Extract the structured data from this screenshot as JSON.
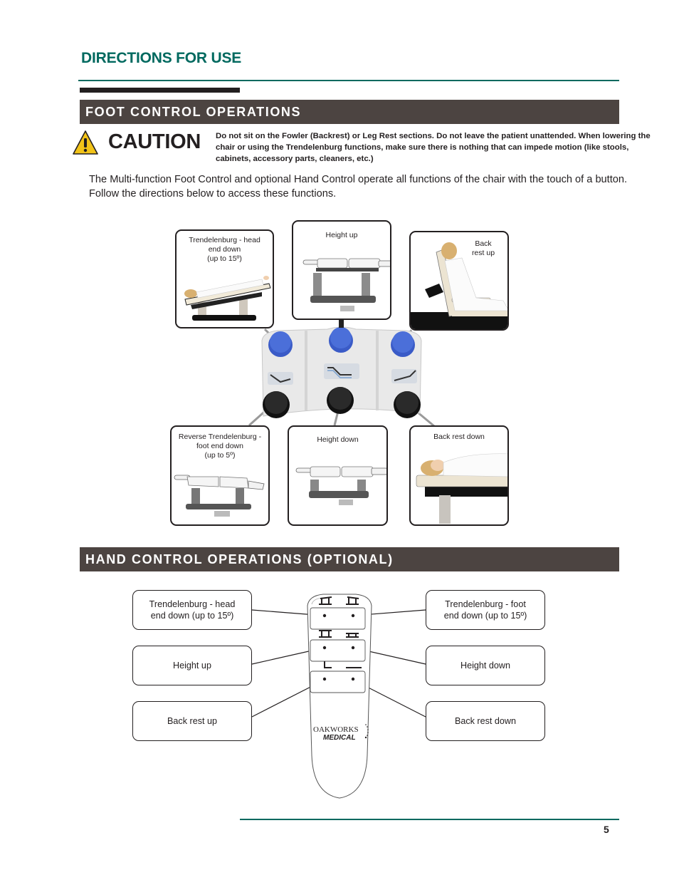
{
  "page": {
    "heading": "DIRECTIONS FOR USE",
    "page_number": "5",
    "colors": {
      "teal": "#00695f",
      "band": "#4c4441",
      "caution_yellow": "#f2c318",
      "pedal_blue": "#3a5bc7",
      "pedal_black": "#1e1e1e"
    }
  },
  "foot_section": {
    "title": "FOOT CONTROL OPERATIONS",
    "caution": {
      "icon": "warning-triangle-icon",
      "label": "CAUTION",
      "text": "Do not sit on the Fowler (Backrest) or Leg Rest sections. Do not leave the patient unattended. When lowering the chair or using the Trendelenburg functions, make sure there is nothing that can impede motion (like stools, cabinets, accessory parts, cleaners, etc.)"
    },
    "intro": "The Multi-function Foot Control and optional Hand Control operate all functions of the chair with the touch of a button. Follow the directions below to access these functions.",
    "panels": [
      {
        "lines": [
          "Trendelenburg - head",
          "end down",
          "(up to 15º)"
        ],
        "image": "table-head-down-with-patient"
      },
      {
        "lines": [
          "Height up"
        ],
        "image": "table-raised"
      },
      {
        "lines": [
          "Back",
          "rest up"
        ],
        "image": "backrest-up-with-patient"
      },
      {
        "lines": [
          "Reverse Trendelenburg -",
          "foot end down",
          "(up to 5º)"
        ],
        "image": "table-foot-down"
      },
      {
        "lines": [
          "Height down"
        ],
        "image": "table-lowered"
      },
      {
        "lines": [
          "Back rest down"
        ],
        "image": "backrest-down-with-patient"
      }
    ],
    "foot_control": {
      "top_pedals": [
        "trendelenburg-head-down",
        "height-up",
        "back-rest-up"
      ],
      "bottom_pedals": [
        "reverse-trendelenburg",
        "height-down",
        "back-rest-down"
      ],
      "labels_icons": [
        "trendelenburg-icon",
        "height-icon",
        "backrest-icon"
      ]
    }
  },
  "hand_section": {
    "title": "HAND CONTROL OPERATIONS (OPTIONAL)",
    "left_callouts": [
      {
        "lines": [
          "Trendelenburg - head",
          "end down (up to 15º)"
        ]
      },
      {
        "lines": [
          "Height up"
        ]
      },
      {
        "lines": [
          "Back rest up"
        ]
      }
    ],
    "right_callouts": [
      {
        "lines": [
          "Trendelenburg - foot",
          "end down (up to 15º)"
        ]
      },
      {
        "lines": [
          "Height down"
        ]
      },
      {
        "lines": [
          "Back rest down"
        ]
      }
    ],
    "remote": {
      "brand_line1": "OAKWORKS",
      "brand_line2": "MEDICAL"
    }
  }
}
